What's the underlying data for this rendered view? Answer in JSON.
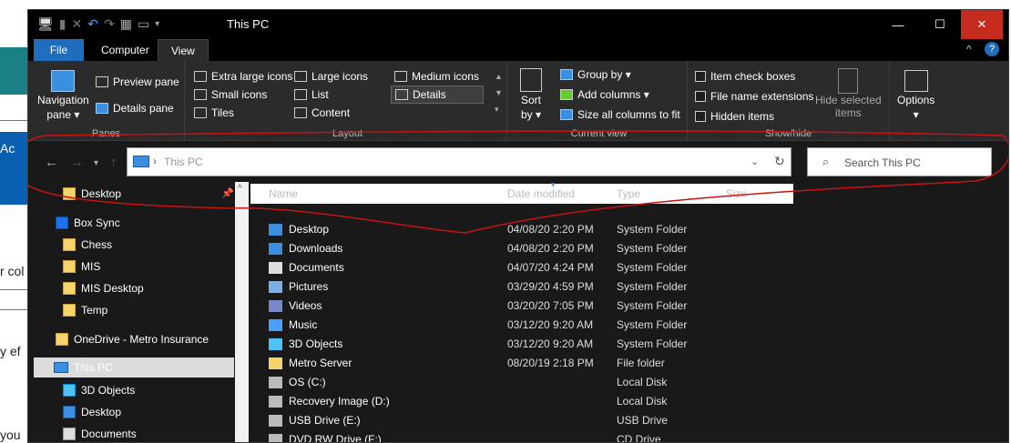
{
  "background": {
    "text_left_1": "Ac",
    "text_left_2": "r col",
    "text_left_3": "y ef",
    "text_left_4": "you"
  },
  "window": {
    "title": "This PC",
    "buttons": {
      "minimize": "—",
      "maximize": "☐",
      "close": "✕"
    }
  },
  "ribbon_tabs": {
    "file": "File",
    "computer": "Computer",
    "view": "View"
  },
  "ribbon": {
    "panes": {
      "label": "Panes",
      "navigation_pane": "Navigation",
      "navigation_pane2": "pane ▾",
      "preview_pane": "Preview pane",
      "details_pane": "Details pane"
    },
    "layout": {
      "label": "Layout",
      "extra_large": "Extra large icons",
      "large": "Large icons",
      "medium": "Medium icons",
      "small": "Small icons",
      "list": "List",
      "details": "Details",
      "tiles": "Tiles",
      "content": "Content"
    },
    "current_view": {
      "label": "Current view",
      "sort": "Sort",
      "sort2": "by ▾",
      "group_by": "Group by ▾",
      "add_columns": "Add columns ▾",
      "size_all": "Size all columns to fit"
    },
    "show_hide": {
      "label": "Show/hide",
      "item_check": "Item check boxes",
      "file_ext": "File name extensions",
      "hidden_items": "Hidden items",
      "hide_selected": "Hide selected",
      "hide_selected2": "items"
    },
    "options": {
      "label": "Options",
      "sub": "▾"
    }
  },
  "address": {
    "path": "This PC"
  },
  "search": {
    "placeholder": "Search This PC"
  },
  "nav": [
    {
      "label": "Desktop",
      "pinned": true
    },
    {
      "label": "Box Sync"
    },
    {
      "label": "Chess"
    },
    {
      "label": "MIS"
    },
    {
      "label": "MIS Desktop"
    },
    {
      "label": "Temp"
    },
    {
      "label": "OneDrive - Metro Insurance"
    },
    {
      "label": "This PC"
    },
    {
      "label": "3D Objects"
    },
    {
      "label": "Desktop"
    },
    {
      "label": "Documents"
    }
  ],
  "columns": {
    "name": "Name",
    "date": "Date modified",
    "type": "Type",
    "size": "Size"
  },
  "files": [
    {
      "name": "Desktop",
      "date": "04/08/20 2:20 PM",
      "type": "System Folder"
    },
    {
      "name": "Downloads",
      "date": "04/08/20 2:20 PM",
      "type": "System Folder"
    },
    {
      "name": "Documents",
      "date": "04/07/20 4:24 PM",
      "type": "System Folder"
    },
    {
      "name": "Pictures",
      "date": "03/29/20 4:59 PM",
      "type": "System Folder"
    },
    {
      "name": "Videos",
      "date": "03/20/20 7:05 PM",
      "type": "System Folder"
    },
    {
      "name": "Music",
      "date": "03/12/20 9:20 AM",
      "type": "System Folder"
    },
    {
      "name": "3D Objects",
      "date": "03/12/20 9:20 AM",
      "type": "System Folder"
    },
    {
      "name": "Metro Server",
      "date": "08/20/19 2:18 PM",
      "type": "File folder"
    },
    {
      "name": "OS (C:)",
      "date": "",
      "type": "Local Disk"
    },
    {
      "name": "Recovery Image (D:)",
      "date": "",
      "type": "Local Disk"
    },
    {
      "name": "USB Drive (E:)",
      "date": "",
      "type": "USB Drive"
    },
    {
      "name": "DVD RW Drive (F:)",
      "date": "",
      "type": "CD Drive"
    }
  ],
  "colors": {
    "accent": "#1e6ebd",
    "annotation": "#cc1111"
  }
}
